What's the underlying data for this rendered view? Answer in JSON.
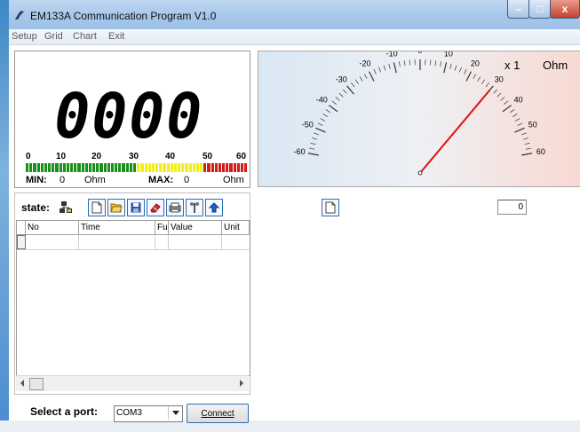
{
  "window": {
    "title": "EM133A Communication Program V1.0",
    "controls": {
      "minimize": "–",
      "maximize": "□",
      "close": "x"
    }
  },
  "menu": [
    "Setup",
    "Grid",
    "Chart",
    "Exit"
  ],
  "display": {
    "value": "0000",
    "bar_ticks": [
      "0",
      "10",
      "20",
      "30",
      "40",
      "50",
      "60"
    ],
    "min_label": "MIN:",
    "min_value": "0",
    "min_unit": "Ohm",
    "max_label": "MAX:",
    "max_value": "0",
    "max_unit": "Ohm",
    "segment_colors": {
      "green": "#1a8f1a",
      "yellow": "#f4ee1a",
      "red": "#d21b1b"
    }
  },
  "log": {
    "state_label": "state:",
    "columns": [
      "No",
      "Time",
      "Fu",
      "Value",
      "Unit"
    ]
  },
  "port": {
    "label": "Select a port:",
    "selected": "COM3",
    "connect_label": "Connect"
  },
  "gauge": {
    "multiplier": "x 1",
    "unit": "Ohm",
    "scale_labels": [
      "-60",
      "-50",
      "-40",
      "-30",
      "-20",
      "-10",
      "0",
      "10",
      "20",
      "30",
      "40",
      "50",
      "60"
    ],
    "needle_value": 30,
    "needle_color": "#e01010"
  },
  "counter_value": "0"
}
